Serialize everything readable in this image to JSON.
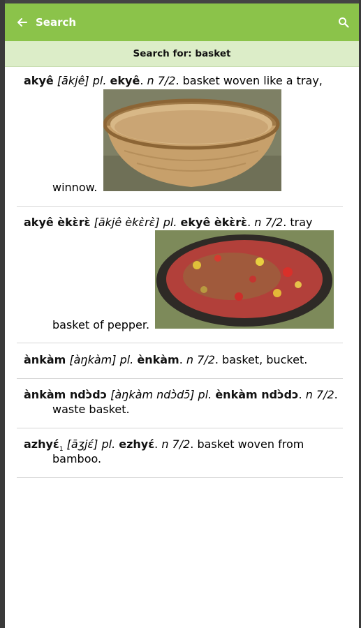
{
  "appbar": {
    "title": "Search"
  },
  "search": {
    "label": "Search for:",
    "term": "basket"
  },
  "entries": [
    {
      "headword": "akyê",
      "pron": "[ākjê]",
      "pl_label": "pl.",
      "plural": "ekyê",
      "class": "n 7/2",
      "def_start": "basket woven like a tray,",
      "def_end": "winnow.",
      "image": "woven-tray-basket"
    },
    {
      "headword": "akyê èkɛ̀rɛ̀",
      "pron": "[ākjê èkɛ̀rɛ̀]",
      "pl_label": "pl.",
      "plural": "ekyê èkɛ̀rɛ̀",
      "class": "n 7/2",
      "def_start": "tray",
      "def_end": "basket of pepper.",
      "image": "tray-basket-of-pepper"
    },
    {
      "headword": "ànkàm",
      "pron": "[àŋkàm]",
      "pl_label": "pl.",
      "plural": "ènkàm",
      "class": "n 7/2",
      "def_start": "basket, bucket."
    },
    {
      "headword": "ànkàm ndɔ̀dɔ",
      "pron": "[àŋkàm ndɔ̀dɔ̄]",
      "pl_label": "pl.",
      "plural": "ènkàm ndɔ̀dɔ",
      "class": "n 7/2",
      "def_end": "waste basket."
    },
    {
      "headword": "azhyɛ́",
      "sub": "1",
      "pron": "[āʒjɛ́]",
      "pl_label": "pl.",
      "plural": "ezhyɛ́",
      "class": "n 7/2",
      "def_start": "basket woven from",
      "def_end": "bamboo."
    }
  ]
}
